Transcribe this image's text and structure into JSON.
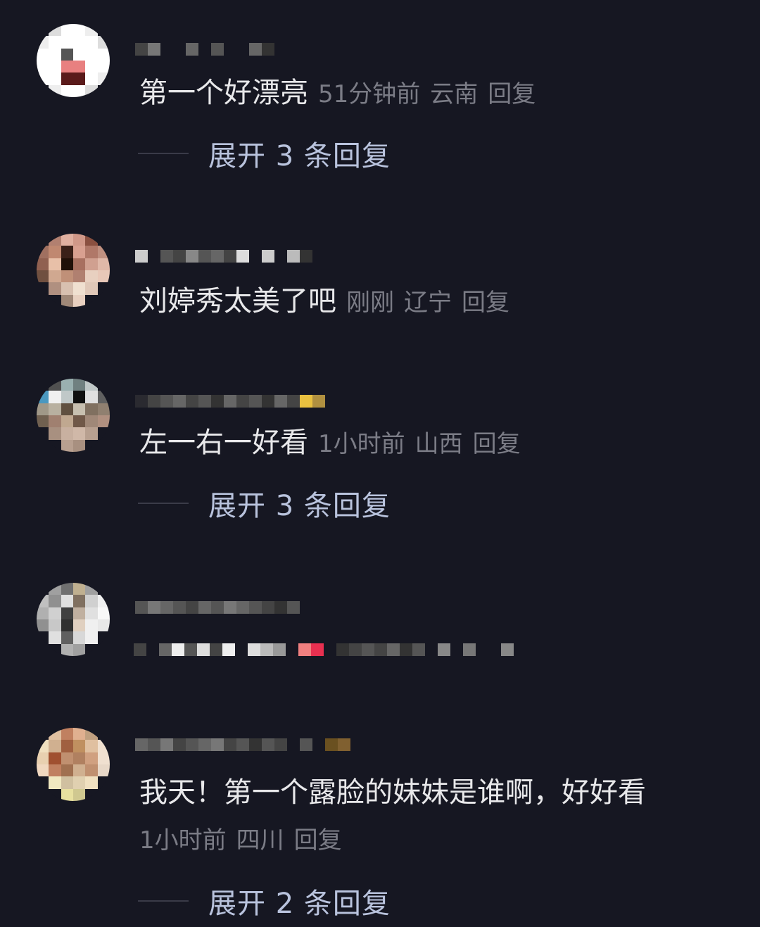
{
  "comments": [
    {
      "text": "第一个好漂亮",
      "time": "51分钟前",
      "location": "云南",
      "reply": "回复",
      "expand": "展开 3 条回复"
    },
    {
      "text": "刘婷秀太美了吧",
      "time": "刚刚",
      "location": "辽宁",
      "reply": "回复"
    },
    {
      "text": "左一右一好看",
      "time": "1小时前",
      "location": "山西",
      "reply": "回复",
      "expand": "展开 3 条回复"
    },
    {
      "text": "",
      "time": "",
      "location": "",
      "reply": ""
    },
    {
      "text": "我天！第一个露脸的妹妹是谁啊，好好看",
      "time": "1小时前",
      "location": "四川",
      "reply": "回复",
      "expand": "展开 2 条回复"
    }
  ],
  "colors": {
    "background": "#161722",
    "text": "#e8e8ea",
    "meta": "#7b7c86",
    "expand": "#b9c3dd"
  }
}
